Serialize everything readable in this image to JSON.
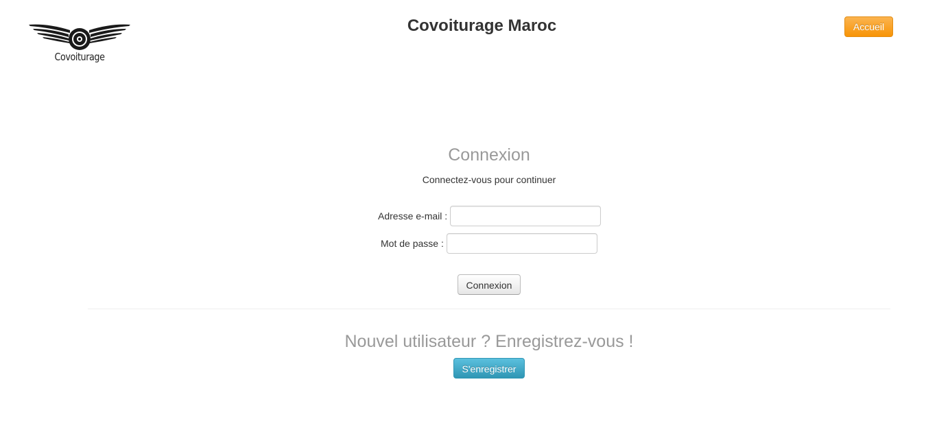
{
  "header": {
    "logo_text": "Covoiturage",
    "site_title": "Covoiturage Maroc",
    "home_button_label": "Accueil"
  },
  "login": {
    "title": "Connexion",
    "subtitle": "Connectez-vous pour continuer",
    "email_label": "Adresse e-mail :",
    "email_value": "",
    "password_label": "Mot de passe :",
    "password_value": "",
    "submit_label": "Connexion"
  },
  "register": {
    "title": "Nouvel utilisateur ? Enregistrez-vous !",
    "button_label": "S'enregistrer"
  },
  "colors": {
    "home_button": "#f89406",
    "register_button": "#2f96b4",
    "heading_gray": "#999999"
  },
  "icons": {
    "logo": "winged-wheel-logo"
  }
}
